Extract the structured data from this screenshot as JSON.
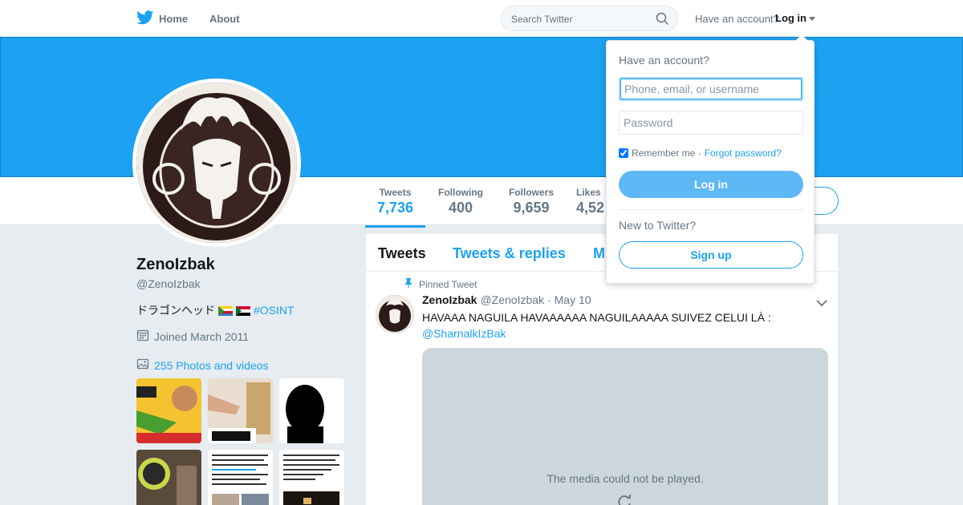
{
  "nav": {
    "home": "Home",
    "about": "About",
    "search_placeholder": "Search Twitter",
    "have_account": "Have an account?",
    "login": "Log in"
  },
  "profile": {
    "name": "ZenoIzbak",
    "handle": "@ZenoIzbak",
    "bio_text": "ドラゴンヘッド",
    "bio_hashtag": "#OSINT",
    "joined": "Joined March 2011",
    "photos_link": "255 Photos and videos"
  },
  "stats": [
    {
      "label": "Tweets",
      "value": "7,736"
    },
    {
      "label": "Following",
      "value": "400"
    },
    {
      "label": "Followers",
      "value": "9,659"
    },
    {
      "label": "Likes",
      "value": "4,52"
    }
  ],
  "timeline": {
    "tabs": [
      "Tweets",
      "Tweets & replies",
      "M"
    ],
    "pinned_label": "Pinned Tweet",
    "tweet": {
      "name": "ZenoIzbak",
      "handle": "@ZenoIzbak",
      "date": "· May 10",
      "text": "HAVAAA NAGUILA HAVAAAAAA NAGUILAAAAA SUIVEZ CELUI LÀ :",
      "mention": "@SharnalkIzBak",
      "media_message": "The media could not be played."
    }
  },
  "login_dropdown": {
    "title": "Have an account?",
    "username_placeholder": "Phone, email, or username",
    "password_placeholder": "Password",
    "remember_me": "Remember me ·",
    "forgot_password": "Forgot password?",
    "login_button": "Log in",
    "new_to_twitter": "New to Twitter?",
    "signup_button": "Sign up"
  },
  "colors": {
    "brand_blue": "#1da1f2",
    "banner": "#1da1f2",
    "page_bg": "#e6ecf0"
  }
}
